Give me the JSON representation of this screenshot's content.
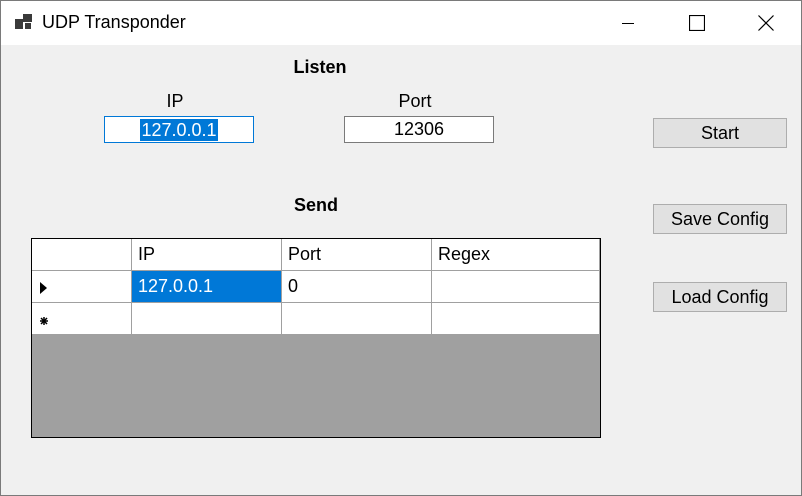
{
  "window": {
    "title": "UDP Transponder",
    "icons": {
      "app": "app-icon",
      "minimize": "minimize-icon",
      "maximize": "maximize-icon",
      "close": "close-icon"
    }
  },
  "listen": {
    "heading": "Listen",
    "ip_label": "IP",
    "ip_value": "127.0.0.1",
    "port_label": "Port",
    "port_value": "12306"
  },
  "send": {
    "heading": "Send",
    "grid": {
      "columns": [
        "IP",
        "Port",
        "Regex"
      ],
      "rows": [
        {
          "ip": "127.0.0.1",
          "port": "0",
          "regex": ""
        }
      ],
      "current_row_indicator": "triangle-right-icon",
      "new_row_indicator": "asterisk-icon"
    }
  },
  "buttons": {
    "start": "Start",
    "save_config": "Save Config",
    "load_config": "Load Config"
  },
  "colors": {
    "selection": "#0078d7",
    "grid_background": "#a0a0a0",
    "button_face": "#e1e1e1"
  }
}
